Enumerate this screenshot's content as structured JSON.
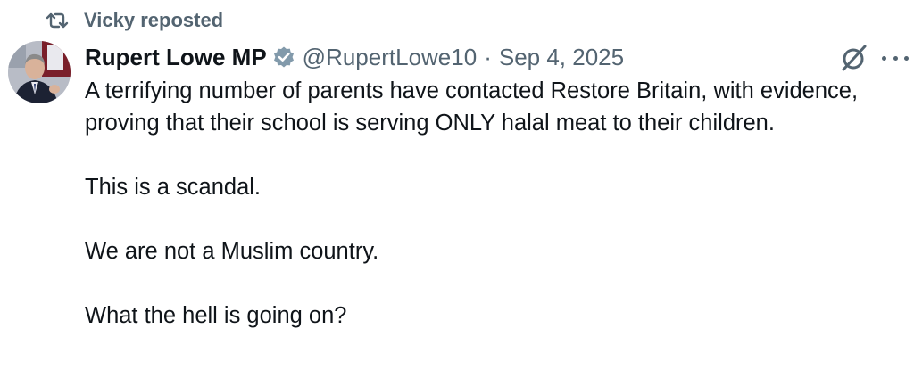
{
  "repost": {
    "text": "Vicky reposted",
    "icon": "repost-icon"
  },
  "post": {
    "author_name": "Rupert Lowe MP",
    "verified_badge": "verified-badge-icon",
    "handle": "@RupertLowe10",
    "separator": "·",
    "date": "Sep 4, 2025",
    "paragraphs": [
      "A terrifying number of parents have contacted Restore Britain, with evidence, proving that their school is serving ONLY halal meat to their children.",
      "This is a scandal.",
      "We are not a Muslim country.",
      "What the hell is going on?"
    ]
  },
  "icons": {
    "grok": "grok-icon",
    "more": "more-options-icon"
  },
  "colors": {
    "text_primary": "#0f1419",
    "text_secondary": "#536471",
    "badge": "#829aab",
    "background": "#ffffff"
  }
}
